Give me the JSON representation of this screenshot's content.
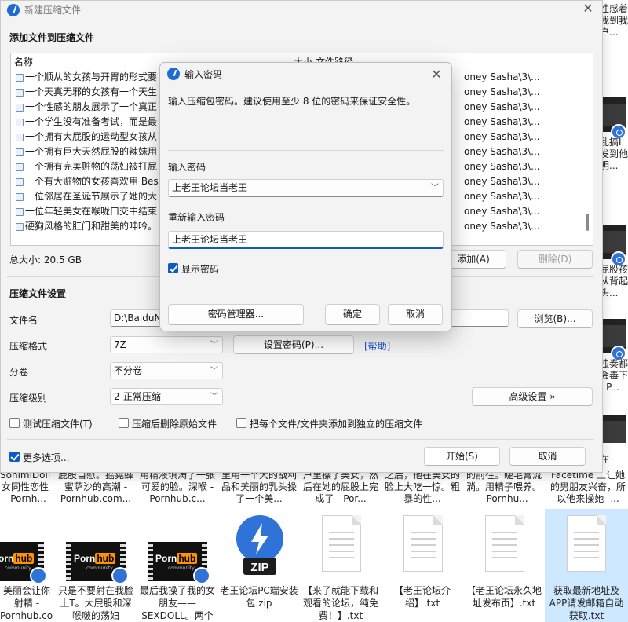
{
  "explorer": {
    "right_tiles": [
      {
        "text": "性感着我到我户..."
      },
      {
        "text": "乱搞Ⅰ发到他明..."
      },
      {
        "text": "屁股孩从背起头..."
      },
      {
        "text": "独奏都会毒下 - P..."
      },
      {
        "text": "在"
      }
    ],
    "snippets": [
      {
        "text": "SonimiDoll女同性恋性 - Pornh..."
      },
      {
        "text": "屁股自慰。摇晃蜂蜜萨沙的高潮 - Pornhub.com..."
      },
      {
        "text": "用精液填满了一张可爱的脸。深喉 - Pornhub.c..."
      },
      {
        "text": "里用一个大的战利品和美丽的乳头操了一个美..."
      },
      {
        "text": "户里操了美女，然后在她的屁股上完成了 - Por..."
      },
      {
        "text": "之后，他在美女的脸上大吃一惊。粗暴的性..."
      },
      {
        "text": "的前往。睫毛膏流淌。用精子喂养。 - Pornhu..."
      },
      {
        "text": "Facetime 上让她的男朋友兴奋，所以他来操她 -..."
      }
    ],
    "files": [
      {
        "name": "美丽会让你射精 - Pornhub.com.m",
        "type": "video",
        "selected": false
      },
      {
        "name": "只是不要射在我脸上T。大屁股和深喉啵的荡妇",
        "type": "video",
        "selected": false
      },
      {
        "name": "最后我操了我的女朋友——SEXDOLL。两个",
        "type": "video",
        "selected": false
      },
      {
        "name": "老王论坛PC端安装包.zip",
        "type": "zip",
        "selected": false
      },
      {
        "name": "【来了就能下载和观看的论坛，纯免费！】.txt",
        "type": "txt",
        "selected": false
      },
      {
        "name": "【老王论坛介绍】.txt",
        "type": "txt",
        "selected": false
      },
      {
        "name": "【老王论坛永久地址发布页】.txt",
        "type": "txt",
        "selected": false
      },
      {
        "name": "获取最新地址及APP请发邮箱自动获取.txt",
        "type": "txt",
        "selected": true
      }
    ],
    "video_logo": {
      "word1": "Porn",
      "word2": "hub",
      "sub": "community"
    },
    "zip_label": "ZIP"
  },
  "main_dialog": {
    "title": "新建压缩文件",
    "add_section": "添加文件到压缩文件",
    "columns": {
      "name": "名称",
      "size": "大小",
      "path": "文件路径"
    },
    "rows": [
      {
        "name": "一个顺从的女孩与开胃的形式要",
        "path": "oney Sasha\\3\\..."
      },
      {
        "name": "一个天真无邪的女孩有一个天生",
        "path": "oney Sasha\\3\\..."
      },
      {
        "name": "一个性感的朋友展示了一个真正",
        "path": "oney Sasha\\3\\..."
      },
      {
        "name": "一个学生没有准备考试，而是最",
        "path": "oney Sasha\\3\\..."
      },
      {
        "name": "一个拥有大屁股的运动型女孩从",
        "path": "oney Sasha\\3\\..."
      },
      {
        "name": "一个拥有巨大天然屁股的辣妹用",
        "path": "oney Sasha\\3\\..."
      },
      {
        "name": "一个拥有完美赃物的荡妇被打屁",
        "path": "oney Sasha\\3\\..."
      },
      {
        "name": "一个有大赃物的女孩喜欢用 Bes",
        "path": "oney Sasha\\3\\..."
      },
      {
        "name": "一位邻居在圣诞节展示了她的大",
        "path": "oney Sasha\\3\\..."
      },
      {
        "name": "一位年轻美女在喉咙口交中结束",
        "path": "oney Sasha\\3\\..."
      },
      {
        "name": "硬狗风格的肛门和甜美的呻吟。",
        "path": "oney Sasha\\3\\..."
      }
    ],
    "total_size": "总大小: 20.5 GB",
    "add_button": "添加(A)",
    "delete_button": "删除(D)",
    "settings_section": "压缩文件设置",
    "filename_label": "文件名",
    "filename_value": "D:\\BaiduN",
    "browse_button": "浏览(B)...",
    "format_label": "压缩格式",
    "format_value": "7Z",
    "set_password_button": "设置密码(P)...",
    "help_link": "[帮助]",
    "volume_label": "分卷",
    "volume_value": "不分卷",
    "level_label": "压缩级别",
    "level_value": "2-正常压缩",
    "advanced_button": "高级设置 »",
    "test_checkbox": "测试压缩文件(T)",
    "delete_after_checkbox": "压缩后删除原始文件",
    "separate_checkbox": "把每个文件/文件夹添加到独立的压缩文件",
    "more_options_checkbox": "更多选项...",
    "start_button": "开始(S)",
    "cancel_button": "取消"
  },
  "password_dialog": {
    "title": "输入密码",
    "description": "输入压缩包密码。建议使用至少 8 位的密码来保证安全性。",
    "password_label": "输入密码",
    "password_value": "上老王论坛当老王",
    "reenter_label": "重新输入密码",
    "reenter_value": "上老王论坛当老王",
    "show_password": "显示密码",
    "manager_button": "密码管理器...",
    "ok_button": "确定",
    "cancel_button": "取消"
  },
  "colors": {
    "accent": "#0f5cbf",
    "app_icon": "#1f6bd6",
    "help_link": "#1a56c8",
    "selected_tile": "#cde8ff"
  }
}
